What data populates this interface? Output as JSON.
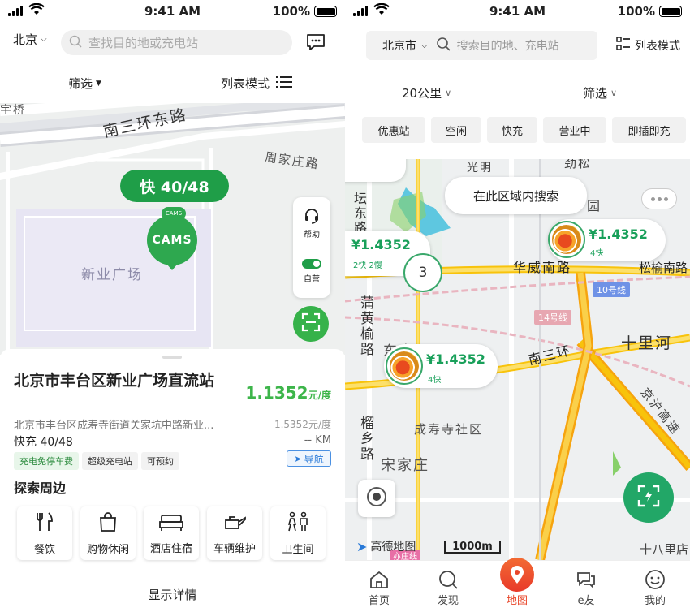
{
  "status": {
    "time": "9:41 AM",
    "battery": "100%"
  },
  "left": {
    "city": "北京",
    "search_placeholder": "查找目的地或充电站",
    "filter": "筛选",
    "list_mode": "列表模式",
    "map_labels": {
      "road1": "南三环东路",
      "road2": "周家庄路",
      "area": "新业广场",
      "bridge": "宇桥"
    },
    "marker_count": "快 40/48",
    "marker_logo": "CAMS",
    "marker_logo_small": "CAMS",
    "side_buttons": {
      "help": "帮助",
      "self": "自营"
    },
    "station": {
      "name": "北京市丰台区新业广场直流站",
      "price": "1.1352",
      "price_unit": "元/度",
      "address": "北京市丰台区成寿寺街道关家坑中路新业...",
      "orig_price": "1.5352元/度",
      "fast": "快充 40/48",
      "distance": "-- KM",
      "tags": [
        "充电免停车费",
        "超级充电站",
        "可预约"
      ],
      "nav": "导航"
    },
    "explore_title": "探索周边",
    "services": [
      "餐饮",
      "购物休闲",
      "酒店住宿",
      "车辆维护",
      "卫生间"
    ],
    "show_details": "显示详情"
  },
  "right": {
    "city": "北京市",
    "search_placeholder": "搜索目的地、充电站",
    "list_mode": "列表模式",
    "distance": "20公里",
    "filter": "筛选",
    "chips": [
      "优惠站",
      "空闲",
      "快充",
      "营业中",
      "即插即充"
    ],
    "search_area": "在此区域内搜索",
    "markers": [
      {
        "price": "¥1.4352",
        "sub": "2快 2慢"
      },
      {
        "price": "¥1.4352",
        "sub": "4快"
      },
      {
        "price": "¥1.4352",
        "sub": "4快"
      }
    ],
    "cluster": "3",
    "map_labels": {
      "r1": "华威南路",
      "r2": "松榆南路",
      "r3": "南三环",
      "r4": "十里河",
      "r5": "成寿寺社区",
      "r6": "宋家庄",
      "r7": "蒲黄榆路",
      "r8": "榴乡路",
      "r9": "坛东路",
      "r10": "东庄",
      "r11": "京沪高速",
      "r12": "十八里店",
      "r13": "园",
      "r14": "光明",
      "r15": "劲松",
      "line10": "10号线",
      "line14": "14号线",
      "line_s": "亦庄线"
    },
    "scale": "1000m",
    "map_brand": "高德地图",
    "tabs": [
      "首页",
      "发现",
      "地图",
      "e友",
      "我的"
    ]
  }
}
